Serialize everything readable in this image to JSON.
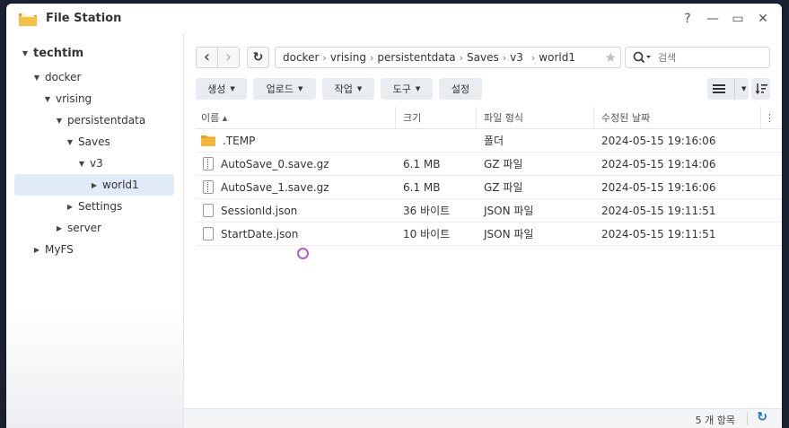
{
  "window": {
    "title": "File Station",
    "help": "?",
    "minimize": "—",
    "maximize": "▭",
    "close": "✕"
  },
  "sidebar": {
    "items": [
      {
        "label": "techtim",
        "caret": "▼"
      },
      {
        "label": "docker",
        "caret": "▼"
      },
      {
        "label": "vrising",
        "caret": "▼"
      },
      {
        "label": "persistentdata",
        "caret": "▼"
      },
      {
        "label": "Saves",
        "caret": "▼"
      },
      {
        "label": "v3",
        "caret": "▼"
      },
      {
        "label": "world1",
        "caret": "▶"
      },
      {
        "label": "Settings",
        "caret": "▶"
      },
      {
        "label": "server",
        "caret": "▶"
      },
      {
        "label": "MyFS",
        "caret": "▶"
      }
    ]
  },
  "nav": {
    "back": "‹",
    "forward": "›",
    "refresh": "↻"
  },
  "path": {
    "segments": [
      "docker",
      "vrising",
      "persistentdata",
      "Saves",
      "v3",
      "world1"
    ],
    "sep": "›",
    "star": "★"
  },
  "search": {
    "placeholder": "검색",
    "icon": "search-icon"
  },
  "actions": {
    "create": "생성",
    "upload": "업로드",
    "action": "작업",
    "tools": "도구",
    "settings": "설정"
  },
  "table": {
    "headers": {
      "name": "이름 ▴",
      "size": "크기",
      "type": "파일 형식",
      "modified": "수정된 날짜",
      "more": "⋮"
    },
    "rows": [
      {
        "name": ".TEMP",
        "size": "",
        "type": "폴더",
        "modified": "2024-05-15 19:16:06",
        "icon": "folder-icon"
      },
      {
        "name": "AutoSave_0.save.gz",
        "size": "6.1 MB",
        "type": "GZ 파일",
        "modified": "2024-05-15 19:14:06",
        "icon": "archive-icon"
      },
      {
        "name": "AutoSave_1.save.gz",
        "size": "6.1 MB",
        "type": "GZ 파일",
        "modified": "2024-05-15 19:16:06",
        "icon": "archive-icon"
      },
      {
        "name": "SessionId.json",
        "size": "36 바이트",
        "type": "JSON 파일",
        "modified": "2024-05-15 19:11:51",
        "icon": "file-icon"
      },
      {
        "name": "StartDate.json",
        "size": "10 바이트",
        "type": "JSON 파일",
        "modified": "2024-05-15 19:11:51",
        "icon": "file-icon"
      }
    ]
  },
  "status": {
    "count": "5 개 항목",
    "refresh": "↻"
  },
  "colors": {
    "accent": "#1d6bc8",
    "folder": "#f1b324",
    "selected": "#e1ebf8"
  }
}
